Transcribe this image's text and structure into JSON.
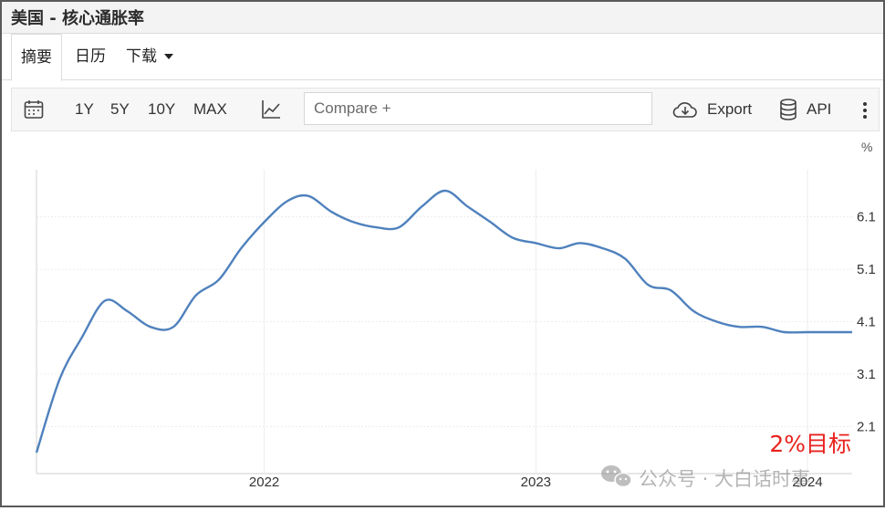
{
  "page": {
    "title": "美国 - 核心通胀率"
  },
  "tabs": [
    {
      "label": "摘要",
      "active": true
    },
    {
      "label": "日历",
      "active": false
    },
    {
      "label": "下载",
      "active": false,
      "dropdown": true
    }
  ],
  "toolbar": {
    "ranges": [
      "1Y",
      "5Y",
      "10Y",
      "MAX"
    ],
    "compare_placeholder": "Compare +",
    "export_label": "Export",
    "api_label": "API",
    "icons": [
      "calendar-icon",
      "chart-type-icon",
      "cloud-download-icon",
      "database-icon",
      "more-vertical-icon"
    ]
  },
  "chart_data": {
    "type": "line",
    "title": "",
    "unit": "%",
    "y_ticks": [
      "6.1",
      "5.1",
      "4.1",
      "3.1",
      "2.1"
    ],
    "ylim": [
      1.2,
      7.0
    ],
    "x_ticks": [
      "2022",
      "2023",
      "2024"
    ],
    "grid": true,
    "line_color": "#4f81bd",
    "series": [
      {
        "name": "",
        "x": [
          "2021-03",
          "2021-04",
          "2021-05",
          "2021-06",
          "2021-07",
          "2021-08",
          "2021-09",
          "2021-10",
          "2021-11",
          "2021-12",
          "2022-01",
          "2022-02",
          "2022-03",
          "2022-04",
          "2022-05",
          "2022-06",
          "2022-07",
          "2022-08",
          "2022-09",
          "2022-10",
          "2022-11",
          "2022-12",
          "2023-01",
          "2023-02",
          "2023-03",
          "2023-04",
          "2023-05",
          "2023-06",
          "2023-07",
          "2023-08",
          "2023-09",
          "2023-10",
          "2023-11",
          "2023-12",
          "2024-01",
          "2024-02",
          "2024-03"
        ],
        "values": [
          1.6,
          3.0,
          3.8,
          4.5,
          4.3,
          4.0,
          4.0,
          4.6,
          4.9,
          5.5,
          6.0,
          6.4,
          6.5,
          6.2,
          6.0,
          5.9,
          5.9,
          6.3,
          6.6,
          6.3,
          6.0,
          5.7,
          5.6,
          5.5,
          5.6,
          5.5,
          5.3,
          4.8,
          4.7,
          4.3,
          4.1,
          4.0,
          4.0,
          3.9,
          3.9,
          3.9,
          3.9
        ]
      }
    ],
    "annotation": "2%目标",
    "annotation_color": "#e8231e"
  },
  "watermark": {
    "text": "公众号 · 大白话时事"
  }
}
